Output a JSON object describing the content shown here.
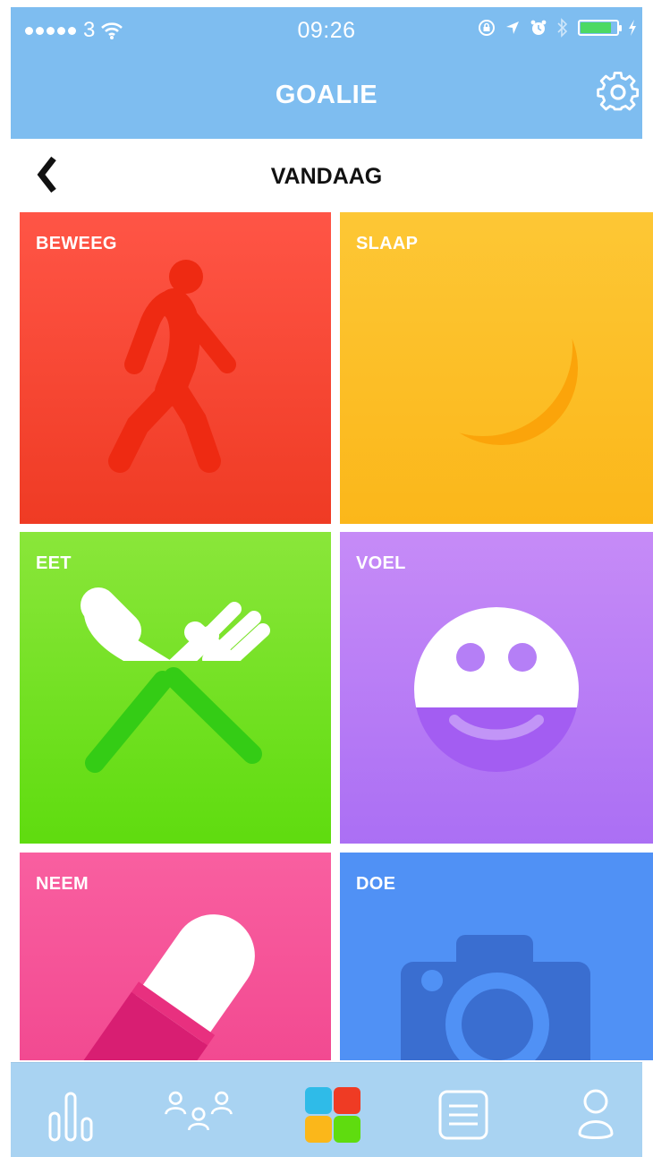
{
  "status_bar": {
    "carrier": "3",
    "time": "09:26",
    "icons": [
      "signal-dots-icon",
      "wifi-icon",
      "orientation-lock-icon",
      "location-icon",
      "alarm-icon",
      "bluetooth-icon",
      "battery-icon",
      "charging-icon"
    ]
  },
  "nav": {
    "title": "GOALIE",
    "settings_icon": "gear-icon"
  },
  "day": {
    "title": "VANDAAG",
    "back_icon": "chevron-left-icon"
  },
  "tiles": [
    {
      "label": "BEWEEG",
      "icon": "walking-person-icon",
      "color": "#ef3b24"
    },
    {
      "label": "SLAAP",
      "icon": "moon-icon",
      "color": "#fbb71a"
    },
    {
      "label": "EET",
      "icon": "knife-fork-icon",
      "color": "#5fdc0f"
    },
    {
      "label": "VOEL",
      "icon": "smiley-face-icon",
      "color": "#ab6ff4"
    },
    {
      "label": "NEEM",
      "icon": "pill-icon",
      "color": "#f24a91"
    },
    {
      "label": "DOE",
      "icon": "camera-icon",
      "color": "#5091f5"
    }
  ],
  "tabbar": {
    "items": [
      {
        "icon": "bar-chart-icon"
      },
      {
        "icon": "group-icon"
      },
      {
        "icon": "grid-tiles-icon",
        "selected": true
      },
      {
        "icon": "list-icon"
      },
      {
        "icon": "profile-icon"
      }
    ]
  },
  "colors": {
    "nav_background": "#7ebdf0",
    "tabbar_background": "#a9d3f2"
  }
}
